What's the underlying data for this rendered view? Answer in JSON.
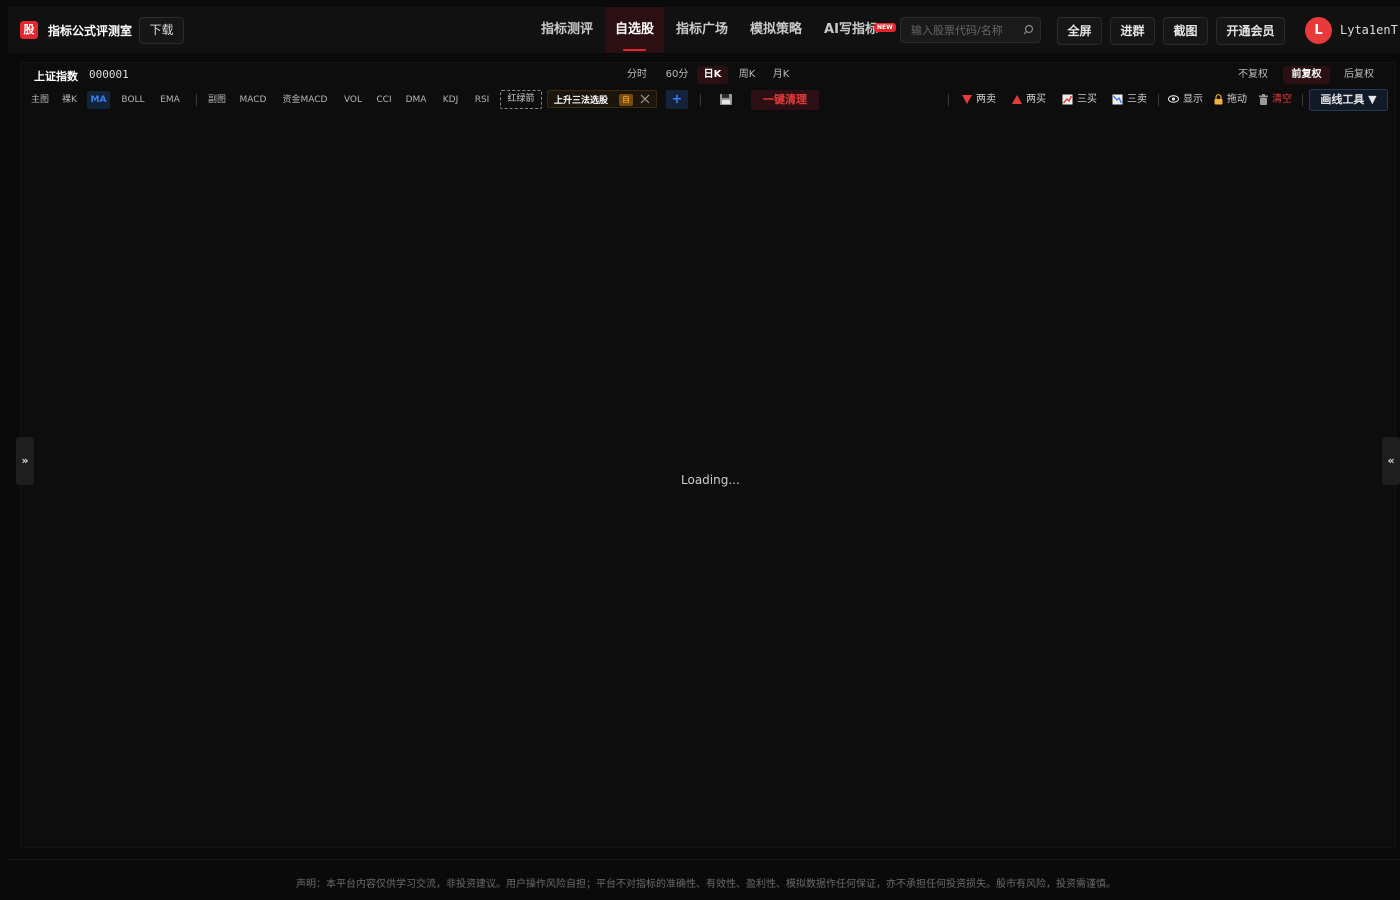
{
  "header": {
    "logo_char": "股",
    "app_title": "指标公式评测室",
    "download_label": "下载",
    "nav_tabs": [
      {
        "label": "指标测评"
      },
      {
        "label": "自选股"
      },
      {
        "label": "指标广场"
      },
      {
        "label": "模拟策略"
      },
      {
        "label": "AI写指标"
      }
    ],
    "new_badge": "NEW",
    "search_placeholder": "输入股票代码/名称",
    "buttons": {
      "fullscreen": "全屏",
      "join_group": "进群",
      "screenshot": "截图",
      "membership": "开通会员"
    },
    "avatar_letter": "L",
    "username": "Lyta1enT"
  },
  "chart_panel": {
    "stock_name": "上证指数",
    "stock_code": "000001",
    "periods": [
      {
        "label": "分时"
      },
      {
        "label": "60分"
      },
      {
        "label": "日K",
        "active": true
      },
      {
        "label": "周K"
      },
      {
        "label": "月K"
      }
    ],
    "adjust": [
      {
        "label": "不复权"
      },
      {
        "label": "前复权",
        "active": true
      },
      {
        "label": "后复权"
      }
    ],
    "main_indicators": [
      "主图",
      "裸K",
      "MA",
      "BOLL",
      "EMA"
    ],
    "active_indicator": "MA",
    "sub_indicators": [
      "副图",
      "MACD",
      "资金MACD",
      "VOL",
      "CCI",
      "DMA",
      "KDJ",
      "RSI"
    ],
    "dashed_tag": "红绿箭",
    "strategy_chip": {
      "name": "上升三法选股",
      "tag": "自"
    },
    "plus_label": "+",
    "clear_all_label": "一键清理",
    "tools": {
      "two_sell": "两卖",
      "two_buy": "两买",
      "three_buy": "三买",
      "three_sell": "三卖",
      "show": "显示",
      "drag": "拖动",
      "clear": "清空"
    },
    "draw_tool_label": "画线工具 ▼",
    "loading_text": "Loading...",
    "left_toggle": "»",
    "right_toggle": "«"
  },
  "footer": {
    "disclaimer": "声明：本平台内容仅供学习交流，非投资建议。用户操作风险自担；平台不对指标的准确性、有效性、盈利性、模拟数据作任何保证，亦不承担任何投资损失。股市有风险，投资需谨慎。"
  },
  "colors": {
    "accent_red": "#e0282e",
    "accent_blue": "#3a7ff0",
    "background": "#0a0a0a"
  }
}
